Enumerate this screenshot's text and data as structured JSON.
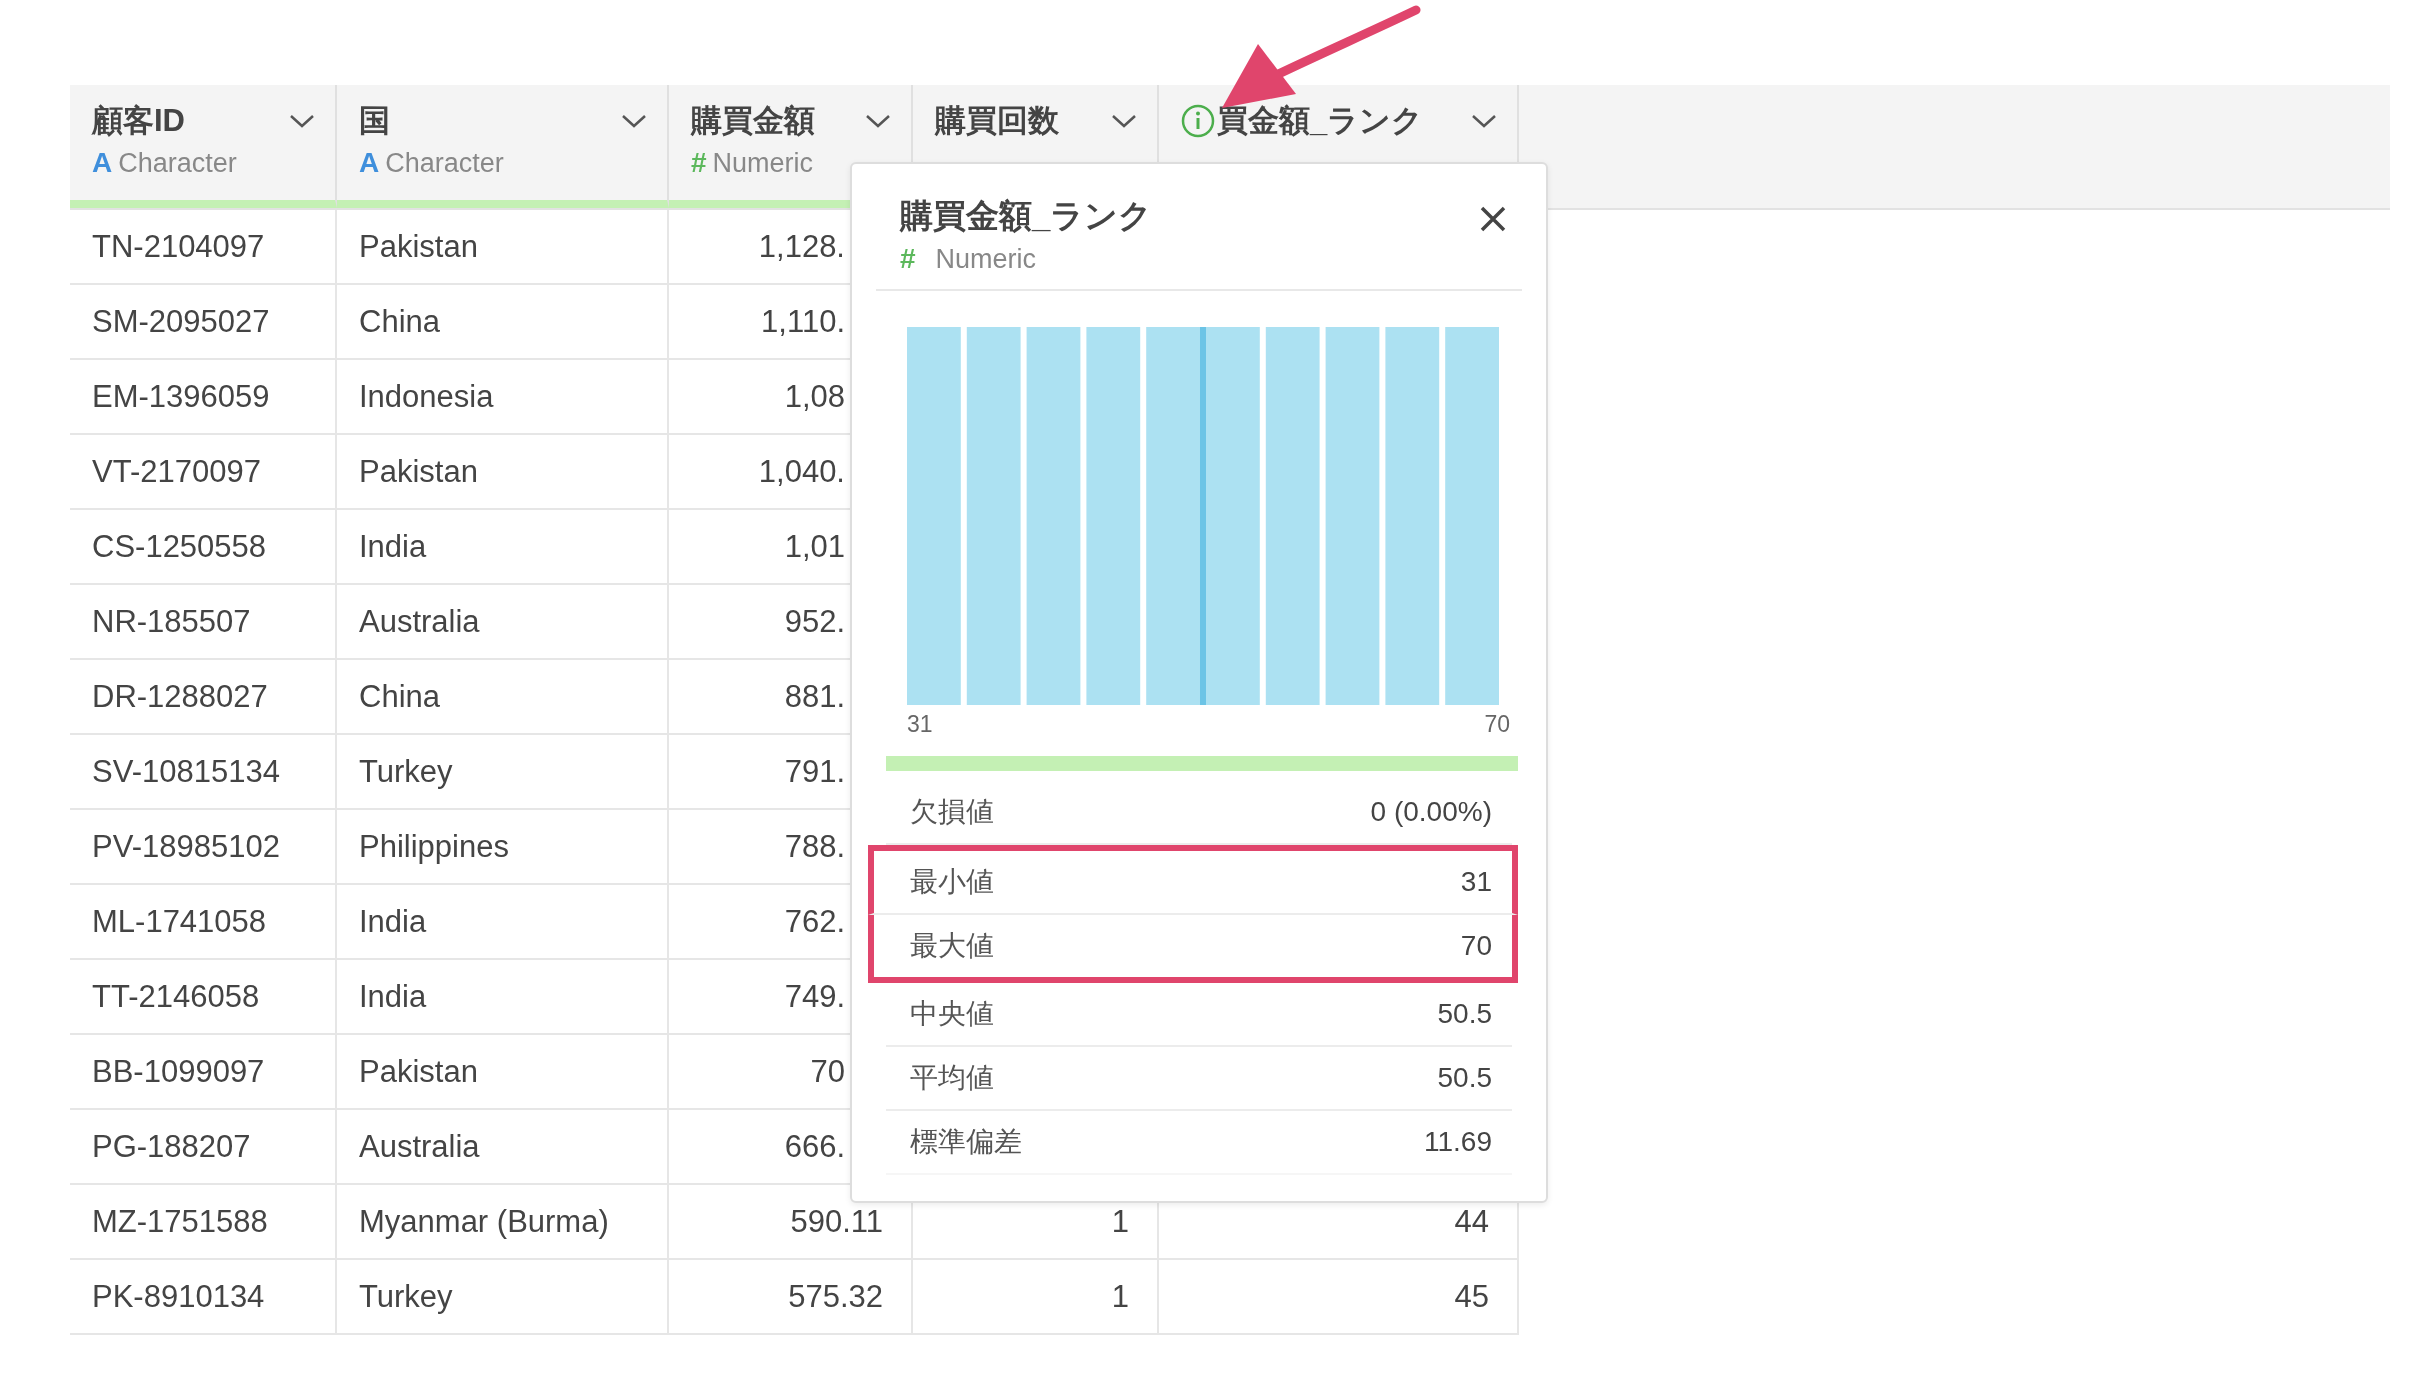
{
  "columns": [
    {
      "title": "顧客ID",
      "type_symbol": "A",
      "type_name": "Character",
      "kind": "character",
      "info_icon": false
    },
    {
      "title": "国",
      "type_symbol": "A",
      "type_name": "Character",
      "kind": "character",
      "info_icon": false
    },
    {
      "title": "購買金額",
      "type_symbol": "#",
      "type_name": "Numeric",
      "kind": "numeric",
      "info_icon": false
    },
    {
      "title": "購買回数",
      "info_icon": false
    },
    {
      "title": "買金額_ランク",
      "info_icon": true
    }
  ],
  "rows": [
    [
      "TN-2104097",
      "Pakistan",
      "1,128."
    ],
    [
      "SM-2095027",
      "China",
      "1,110."
    ],
    [
      "EM-1396059",
      "Indonesia",
      "1,08"
    ],
    [
      "VT-2170097",
      "Pakistan",
      "1,040."
    ],
    [
      "CS-1250558",
      "India",
      "1,01"
    ],
    [
      "NR-185507",
      "Australia",
      "952."
    ],
    [
      "DR-1288027",
      "China",
      "881."
    ],
    [
      "SV-10815134",
      "Turkey",
      "791."
    ],
    [
      "PV-18985102",
      "Philippines",
      "788."
    ],
    [
      "ML-1741058",
      "India",
      "762."
    ],
    [
      "TT-2146058",
      "India",
      "749."
    ],
    [
      "BB-1099097",
      "Pakistan",
      "70"
    ],
    [
      "PG-188207",
      "Australia",
      "666."
    ],
    [
      "MZ-1751588",
      "Myanmar (Burma)",
      "590.11",
      "1",
      "44"
    ],
    [
      "PK-8910134",
      "Turkey",
      "575.32",
      "1",
      "45"
    ]
  ],
  "popup": {
    "title": "購買金額_ランク",
    "type_symbol": "#",
    "type_name": "Numeric",
    "kind": "numeric",
    "histogram": {
      "x_min_label": "31",
      "x_max_label": "70"
    },
    "valid_bar": {
      "level": 1
    },
    "stats": [
      {
        "label": "欠損値",
        "value": "0 (0.00%)",
        "highlighted": false
      },
      {
        "label": "最小値",
        "value": "31",
        "highlighted": true
      },
      {
        "label": "最大値",
        "value": "70",
        "highlighted": true
      },
      {
        "label": "中央値",
        "value": "50.5",
        "highlighted": false
      },
      {
        "label": "平均値",
        "value": "50.5",
        "highlighted": false
      },
      {
        "label": "標準偏差",
        "value": "11.69",
        "highlighted": false
      }
    ]
  },
  "callout_arrow": true
}
